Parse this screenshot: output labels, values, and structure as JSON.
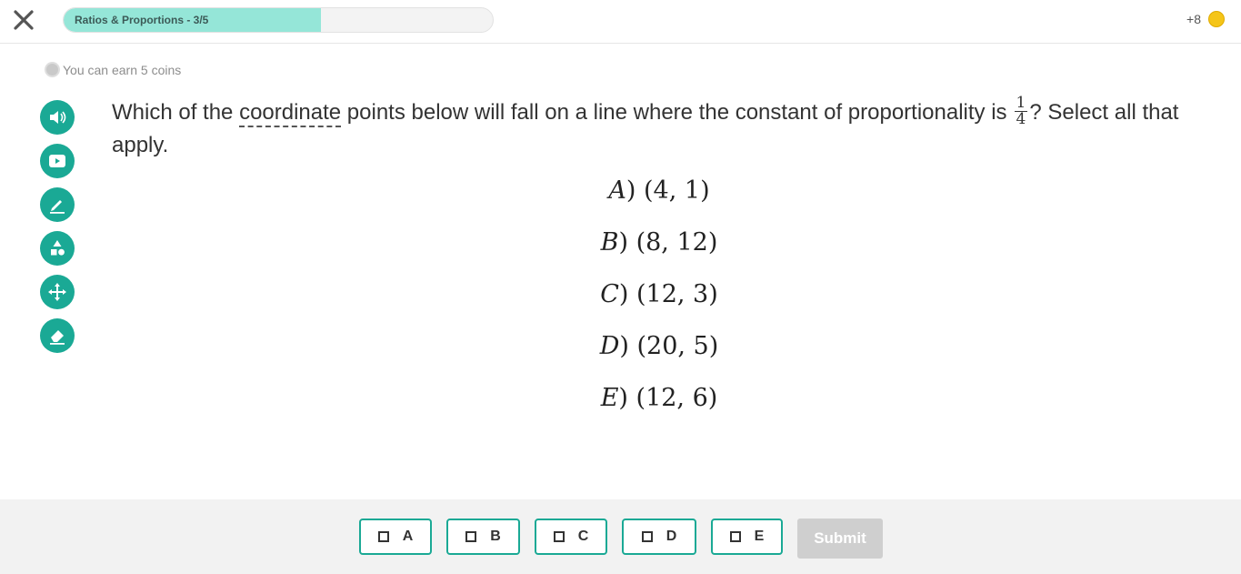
{
  "header": {
    "progress_label": "Ratios & Proportions - 3/5",
    "progress_fraction": 0.6,
    "coins_text": "+8",
    "coin_color": "#f5c518"
  },
  "earn_text": "You can earn 5 coins",
  "tools": [
    {
      "name": "read-aloud-icon"
    },
    {
      "name": "video-icon"
    },
    {
      "name": "pencil-icon"
    },
    {
      "name": "shapes-icon"
    },
    {
      "name": "move-icon"
    },
    {
      "name": "eraser-icon"
    }
  ],
  "question": {
    "part1": "Which of the ",
    "vocab_word": "coordinate",
    "part2": " points below will fall on a line where the constant of proportionality is",
    "fraction_numerator": "1",
    "fraction_denominator": "4",
    "part3": "? Select all that apply."
  },
  "options": [
    {
      "letter": "A",
      "point": "(4, 1)"
    },
    {
      "letter": "B",
      "point": "(8, 12)"
    },
    {
      "letter": "C",
      "point": "(12, 3)"
    },
    {
      "letter": "D",
      "point": "(20, 5)"
    },
    {
      "letter": "E",
      "point": "(12, 6)"
    }
  ],
  "answers": [
    "A",
    "B",
    "C",
    "D",
    "E"
  ],
  "submit_label": "Submit",
  "colors": {
    "accent": "#1aa995",
    "progress_fill": "#95e6d8",
    "submit_disabled": "#cfcfcf"
  }
}
